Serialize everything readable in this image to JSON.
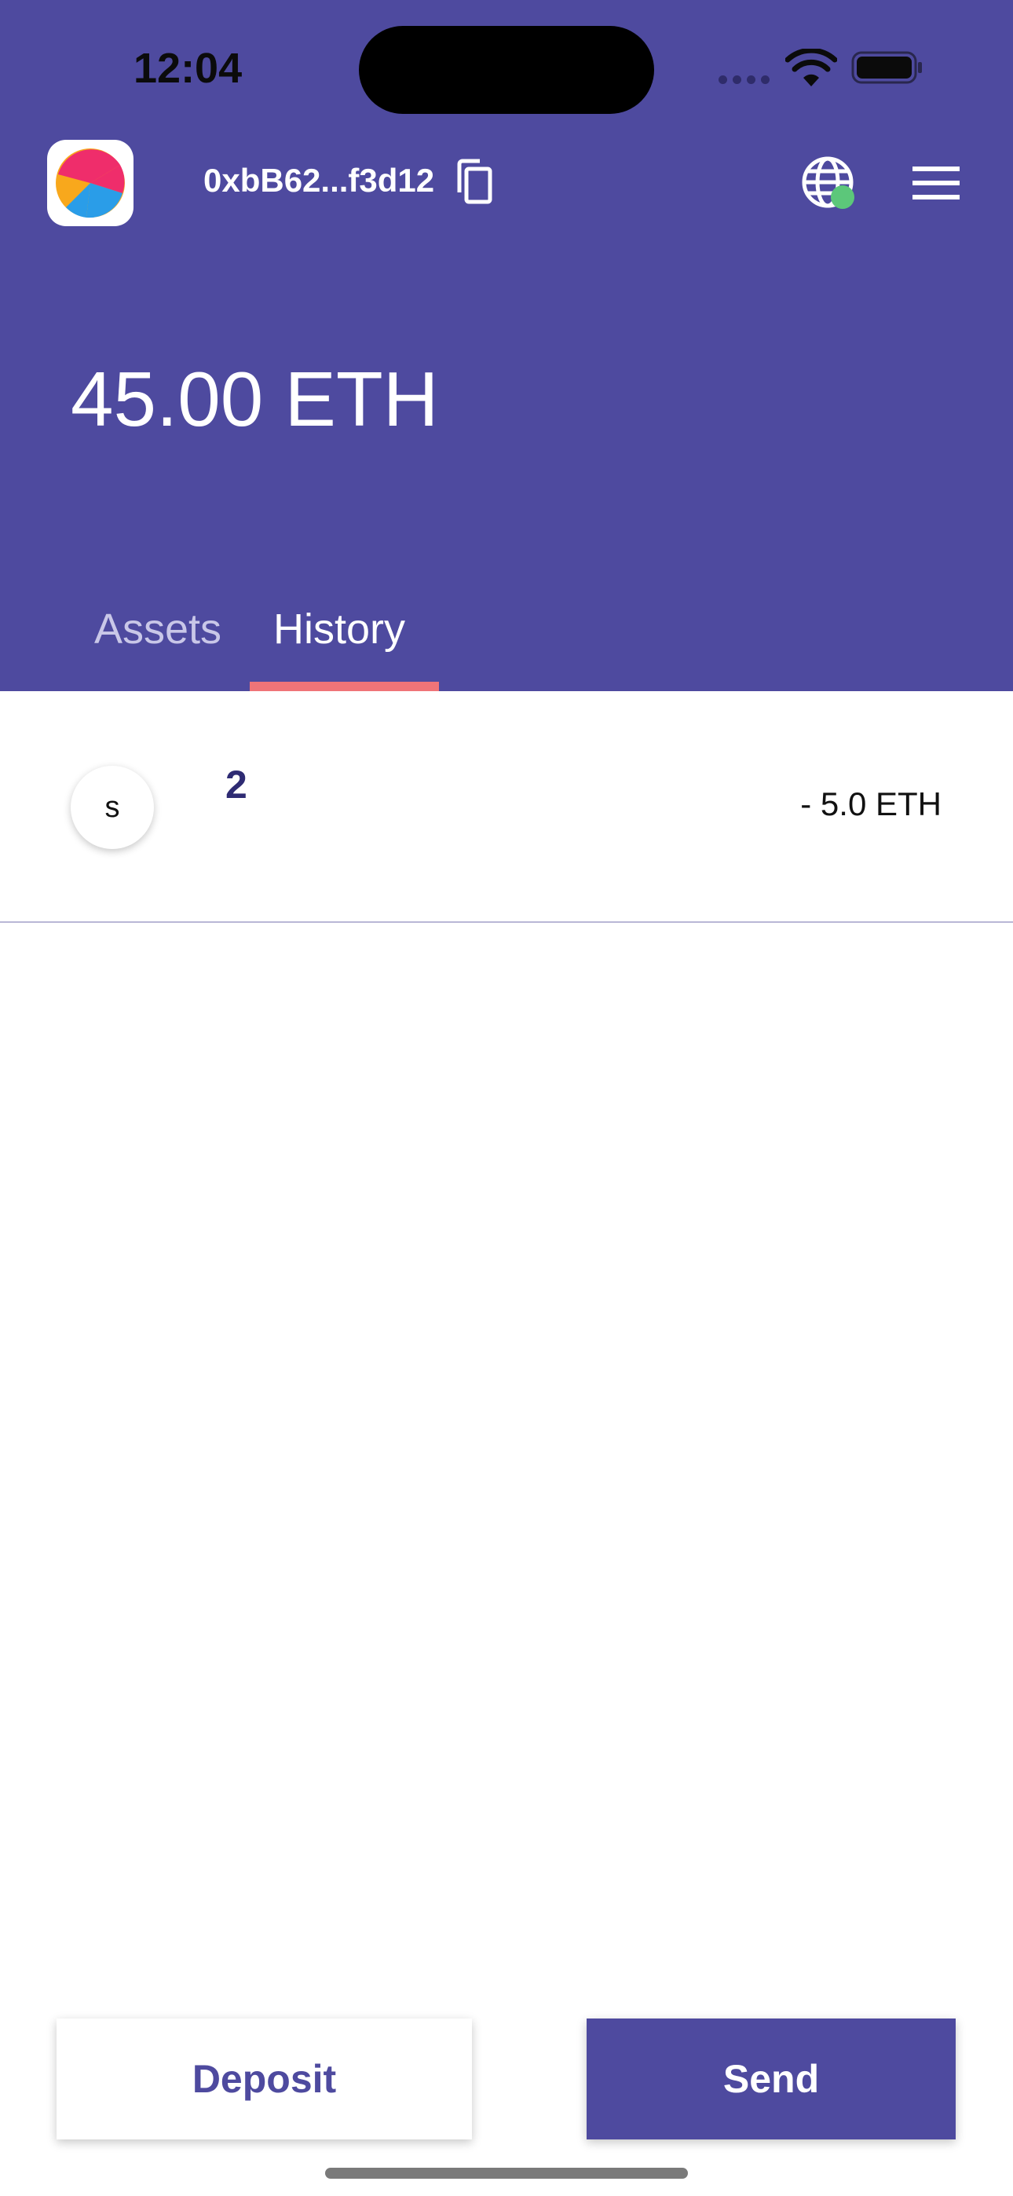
{
  "status_bar": {
    "time": "12:04"
  },
  "header": {
    "address": "0xbB62...f3d12",
    "balance": "45.00 ETH",
    "network_status_color": "#5cc77a",
    "icons": {
      "logo": "app-logo",
      "copy": "copy-icon",
      "network": "globe-icon",
      "menu": "hamburger-menu-icon"
    }
  },
  "tabs": [
    {
      "label": "Assets",
      "active": false
    },
    {
      "label": "History",
      "active": true
    }
  ],
  "history": [
    {
      "avatar_letter": "s",
      "title": "2",
      "amount": "- 5.0 ETH"
    }
  ],
  "actions": {
    "deposit_label": "Deposit",
    "send_label": "Send"
  },
  "colors": {
    "primary": "#4e4a9f",
    "tab_indicator": "#ef7478",
    "text_dark": "#2e2b73"
  }
}
